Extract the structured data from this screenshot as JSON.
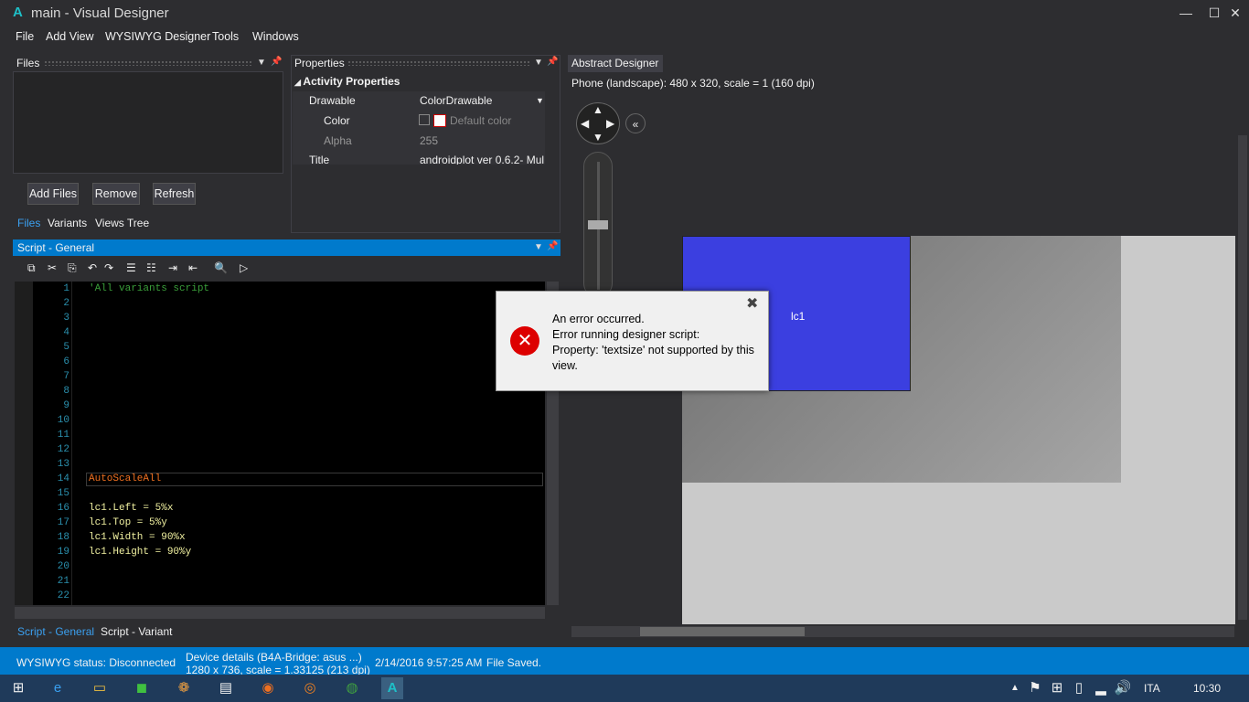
{
  "window": {
    "logo": "A",
    "title": "main - Visual Designer",
    "minimize": "—",
    "maximize": "☐",
    "close": "✕"
  },
  "menu": [
    "File",
    "Add View",
    "WYSIWYG Designer",
    "Tools",
    "Windows"
  ],
  "files_panel": {
    "title": "Files",
    "buttons": {
      "add": "Add Files",
      "remove": "Remove",
      "refresh": "Refresh"
    },
    "tabs": [
      "Files",
      "Variants",
      "Views Tree"
    ]
  },
  "properties": {
    "title": "Properties",
    "section": "Activity Properties",
    "rows": [
      {
        "name": "Drawable",
        "value": "ColorDrawable"
      },
      {
        "name": "Color",
        "value": "Default color"
      },
      {
        "name": "Alpha",
        "value": "255"
      },
      {
        "name": "Title",
        "value": "androidplot ver 0.6.2- Mul"
      }
    ]
  },
  "script": {
    "title": "Script - General",
    "lines": [
      {
        "n": "1",
        "text": "'All variants script",
        "color": "#3a9f3a"
      },
      {
        "n": "2",
        "text": ""
      },
      {
        "n": "3",
        "text": ""
      },
      {
        "n": "4",
        "text": ""
      },
      {
        "n": "5",
        "text": ""
      },
      {
        "n": "6",
        "text": ""
      },
      {
        "n": "7",
        "text": ""
      },
      {
        "n": "8",
        "text": ""
      },
      {
        "n": "9",
        "text": ""
      },
      {
        "n": "10",
        "text": ""
      },
      {
        "n": "11",
        "text": ""
      },
      {
        "n": "12",
        "text": ""
      },
      {
        "n": "13",
        "text": ""
      },
      {
        "n": "14",
        "text": "AutoScaleAll",
        "color": "#f07020"
      },
      {
        "n": "15",
        "text": ""
      },
      {
        "n": "16",
        "text": "lc1.Left = 5%x",
        "color": "#f0f0a0"
      },
      {
        "n": "17",
        "text": "lc1.Top = 5%y",
        "color": "#f0f0a0"
      },
      {
        "n": "18",
        "text": "lc1.Width = 90%x",
        "color": "#f0f0a0"
      },
      {
        "n": "19",
        "text": "lc1.Height = 90%y",
        "color": "#f0f0a0"
      },
      {
        "n": "20",
        "text": ""
      },
      {
        "n": "21",
        "text": ""
      },
      {
        "n": "22",
        "text": ""
      }
    ],
    "tabs": [
      "Script - General",
      "Script - Variant"
    ]
  },
  "designer": {
    "title": "Abstract Designer",
    "device": "Phone (landscape): 480 x 320, scale = 1 (160 dpi)",
    "view_label": "lc1",
    "view_color": "#3b3fe0"
  },
  "dialog": {
    "lines": [
      "An error occurred.",
      "Error running designer script:",
      "Property: 'textsize' not supported by this",
      "view."
    ]
  },
  "status": {
    "wysiwyg": "WYSIWYG status: Disconnected",
    "device1": "Device details (B4A-Bridge: asus ...)",
    "device2": "1280 x 736, scale = 1.33125 (213 dpi)",
    "time": "2/14/2016 9:57:25 AM",
    "saved": "File Saved."
  },
  "taskbar": {
    "lang": "ITA",
    "clock": "10:30"
  }
}
